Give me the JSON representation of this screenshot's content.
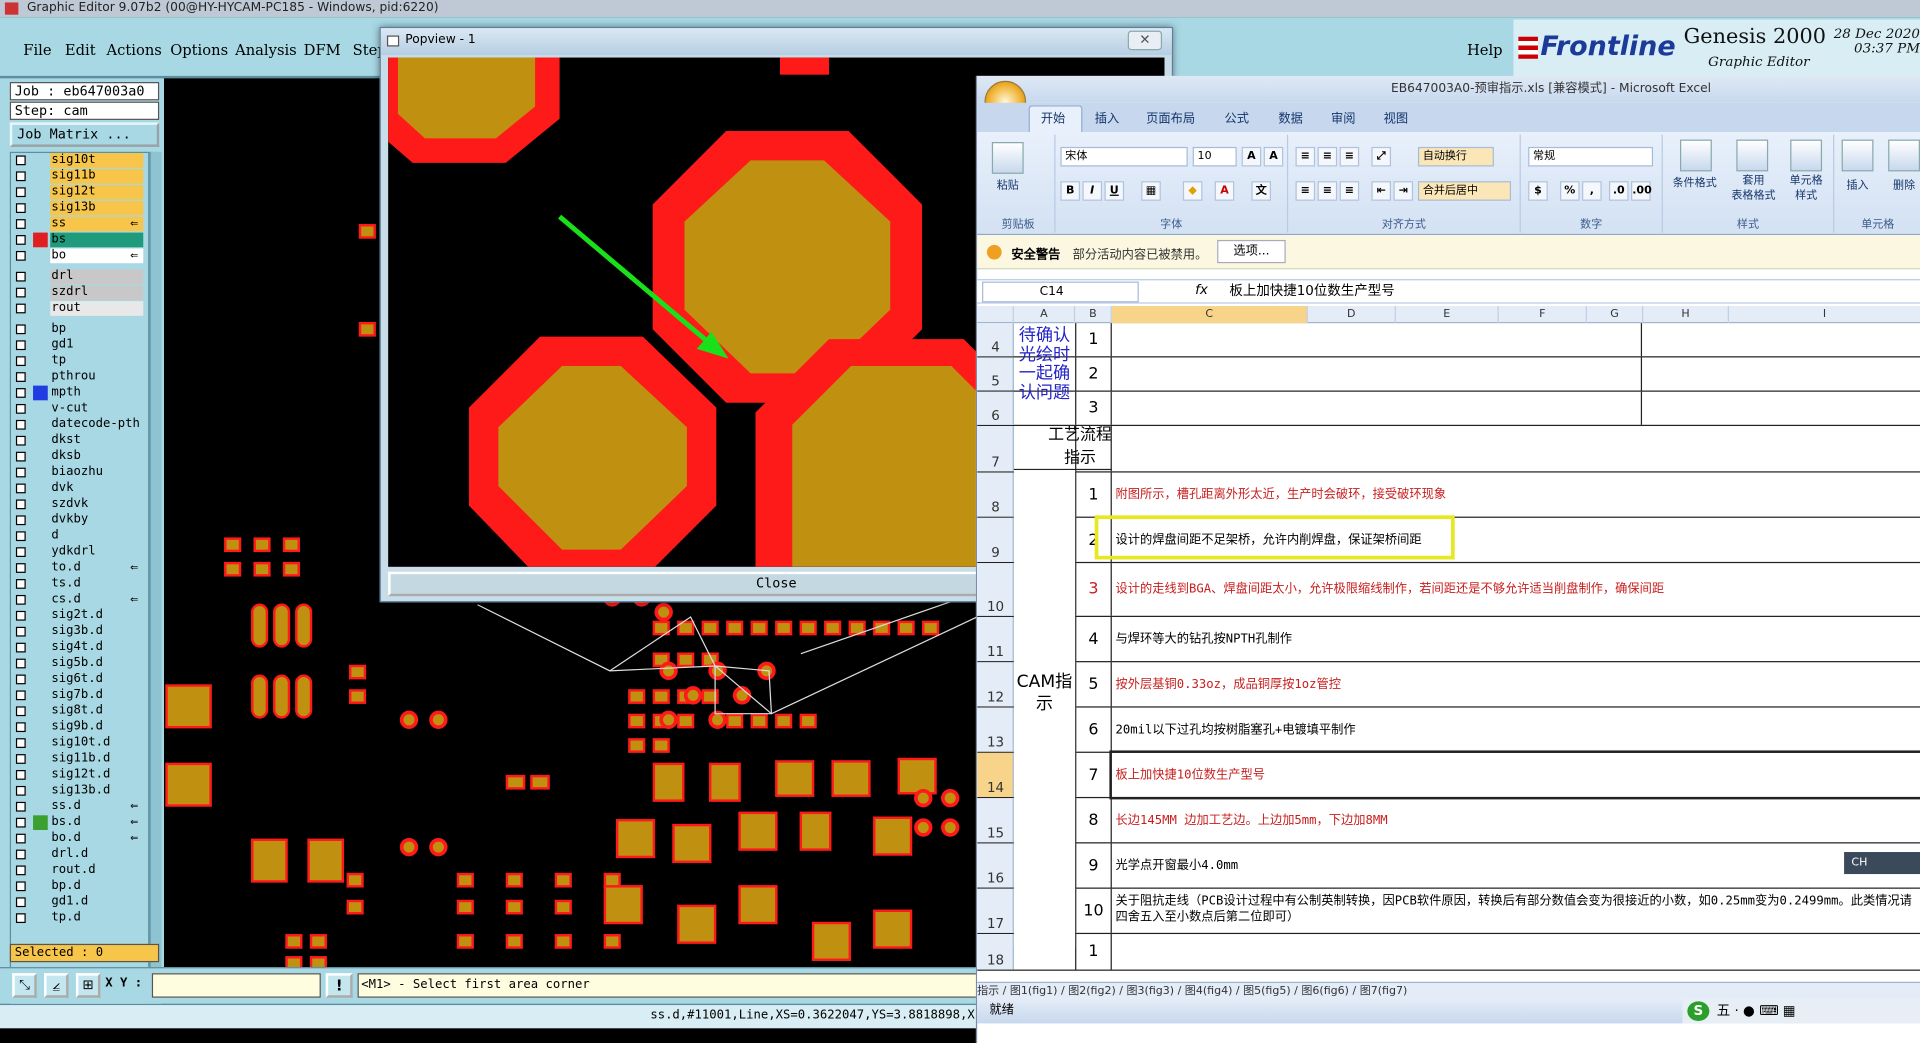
{
  "genesis": {
    "window_title": "Graphic Editor 9.07b2 (00@HY-HYCAM-PC185 - Windows, pid:6220)",
    "menu": [
      "File",
      "Edit",
      "Actions",
      "Options",
      "Analysis",
      "DFM",
      "Step"
    ],
    "help": "Help",
    "brand": "Frontline",
    "product": "Genesis 2000",
    "product_sub": "Graphic Editor",
    "date": "28 Dec 2020",
    "time": "03:37 PM",
    "job": "Job : eb647003a0",
    "step": "Step: cam",
    "job_matrix": "Job Matrix ...",
    "selected": "Selected : 0",
    "xy_label": "X Y :",
    "prompt": "<M1> - Select first area corner",
    "status": "ss.d,#11001,Line,XS=0.3622047,YS=3.8818898,X",
    "layers": [
      {
        "name": "sig10t",
        "bg": "#f6c54a",
        "mark": "",
        "flag": ""
      },
      {
        "name": "sig11b",
        "bg": "#f6c54a",
        "mark": "",
        "flag": ""
      },
      {
        "name": "sig12t",
        "bg": "#f6c54a",
        "mark": "",
        "flag": ""
      },
      {
        "name": "sig13b",
        "bg": "#f6c54a",
        "mark": "",
        "flag": ""
      },
      {
        "name": "ss",
        "bg": "#f6c54a",
        "mark": "",
        "flag": "⇐"
      },
      {
        "name": "bs",
        "bg": "#1f9a7a",
        "mark": "#e02020",
        "flag": ""
      },
      {
        "name": "bo",
        "bg": "#ffffff",
        "mark": "",
        "flag": "⇐"
      },
      {
        "name": "drl",
        "bg": "#c8c8c8",
        "mark": "",
        "flag": ""
      },
      {
        "name": "szdrl",
        "bg": "#c8c8c8",
        "mark": "",
        "flag": ""
      },
      {
        "name": "rout",
        "bg": "#e8e8e8",
        "mark": "",
        "flag": ""
      },
      {
        "name": "bp",
        "bg": "#a8d8e4",
        "mark": "",
        "flag": ""
      },
      {
        "name": "gd1",
        "bg": "#a8d8e4",
        "mark": "",
        "flag": ""
      },
      {
        "name": "tp",
        "bg": "#a8d8e4",
        "mark": "",
        "flag": ""
      },
      {
        "name": "pthrou",
        "bg": "#a8d8e4",
        "mark": "",
        "flag": ""
      },
      {
        "name": "mpth",
        "bg": "#a8d8e4",
        "mark": "#1f3de0",
        "flag": ""
      },
      {
        "name": "v-cut",
        "bg": "#a8d8e4",
        "mark": "",
        "flag": ""
      },
      {
        "name": "datecode-pth",
        "bg": "#a8d8e4",
        "mark": "",
        "flag": ""
      },
      {
        "name": "dkst",
        "bg": "#a8d8e4",
        "mark": "",
        "flag": ""
      },
      {
        "name": "dksb",
        "bg": "#a8d8e4",
        "mark": "",
        "flag": ""
      },
      {
        "name": "biaozhu",
        "bg": "#a8d8e4",
        "mark": "",
        "flag": ""
      },
      {
        "name": "dvk",
        "bg": "#a8d8e4",
        "mark": "",
        "flag": ""
      },
      {
        "name": "szdvk",
        "bg": "#a8d8e4",
        "mark": "",
        "flag": ""
      },
      {
        "name": "dvkby",
        "bg": "#a8d8e4",
        "mark": "",
        "flag": ""
      },
      {
        "name": "d",
        "bg": "#a8d8e4",
        "mark": "",
        "flag": ""
      },
      {
        "name": "ydkdrl",
        "bg": "#a8d8e4",
        "mark": "",
        "flag": ""
      },
      {
        "name": "to.d",
        "bg": "#a8d8e4",
        "mark": "",
        "flag": "⇐"
      },
      {
        "name": "ts.d",
        "bg": "#a8d8e4",
        "mark": "",
        "flag": ""
      },
      {
        "name": "cs.d",
        "bg": "#a8d8e4",
        "mark": "",
        "flag": "⇐"
      },
      {
        "name": "sig2t.d",
        "bg": "#a8d8e4",
        "mark": "",
        "flag": ""
      },
      {
        "name": "sig3b.d",
        "bg": "#a8d8e4",
        "mark": "",
        "flag": ""
      },
      {
        "name": "sig4t.d",
        "bg": "#a8d8e4",
        "mark": "",
        "flag": ""
      },
      {
        "name": "sig5b.d",
        "bg": "#a8d8e4",
        "mark": "",
        "flag": ""
      },
      {
        "name": "sig6t.d",
        "bg": "#a8d8e4",
        "mark": "",
        "flag": ""
      },
      {
        "name": "sig7b.d",
        "bg": "#a8d8e4",
        "mark": "",
        "flag": ""
      },
      {
        "name": "sig8t.d",
        "bg": "#a8d8e4",
        "mark": "",
        "flag": ""
      },
      {
        "name": "sig9b.d",
        "bg": "#a8d8e4",
        "mark": "",
        "flag": ""
      },
      {
        "name": "sig10t.d",
        "bg": "#a8d8e4",
        "mark": "",
        "flag": ""
      },
      {
        "name": "sig11b.d",
        "bg": "#a8d8e4",
        "mark": "",
        "flag": ""
      },
      {
        "name": "sig12t.d",
        "bg": "#a8d8e4",
        "mark": "",
        "flag": ""
      },
      {
        "name": "sig13b.d",
        "bg": "#a8d8e4",
        "mark": "",
        "flag": ""
      },
      {
        "name": "ss.d",
        "bg": "#a8d8e4",
        "mark": "",
        "flag": "⇐"
      },
      {
        "name": "bs.d",
        "bg": "#a8d8e4",
        "mark": "#3aa030",
        "flag": "⇐"
      },
      {
        "name": "bo.d",
        "bg": "#a8d8e4",
        "mark": "",
        "flag": "⇐"
      },
      {
        "name": "drl.d",
        "bg": "#a8d8e4",
        "mark": "",
        "flag": ""
      },
      {
        "name": "rout.d",
        "bg": "#a8d8e4",
        "mark": "",
        "flag": ""
      },
      {
        "name": "bp.d",
        "bg": "#a8d8e4",
        "mark": "",
        "flag": ""
      },
      {
        "name": "gd1.d",
        "bg": "#a8d8e4",
        "mark": "",
        "flag": ""
      },
      {
        "name": "tp.d",
        "bg": "#a8d8e4",
        "mark": "",
        "flag": ""
      }
    ]
  },
  "popview": {
    "title": "Popview - 1",
    "close": "Close"
  },
  "excel": {
    "title": "EB647003A0-预审指示.xls [兼容模式] - Microsoft Excel",
    "tabs": [
      "开始",
      "插入",
      "页面布局",
      "公式",
      "数据",
      "审阅",
      "视图"
    ],
    "ribbon": {
      "paste": "粘贴",
      "clipboard": "剪贴板",
      "font_name": "宋体",
      "font_size": "10",
      "font_group": "字体",
      "wrap": "自动换行",
      "merge": "合并后居中",
      "align_group": "对齐方式",
      "number_format": "常规",
      "number_group": "数字",
      "cond_format": "条件格式",
      "table_format": "套用\n表格格式",
      "cell_style": "单元格\n样式",
      "styles_group": "样式",
      "insert": "插入",
      "delete": "删除",
      "cells_group": "单元格"
    },
    "security_title": "安全警告",
    "security_text": "部分活动内容已被禁用。",
    "security_btn": "选项...",
    "namebox": "C14",
    "fx": "fx",
    "formula": "板上加快捷10位数生产型号",
    "columns": [
      "A",
      "B",
      "C",
      "D",
      "E",
      "F",
      "G",
      "H",
      "I"
    ],
    "label_confirm": "待确认光绘时一起确认问题",
    "label_process": "工艺流程指示",
    "label_cam": "CAM指示",
    "rows": [
      {
        "rn": "4",
        "b": "1",
        "text": "",
        "color": "#000"
      },
      {
        "rn": "5",
        "b": "2",
        "text": "",
        "color": "#000"
      },
      {
        "rn": "6",
        "b": "3",
        "text": "",
        "color": "#000"
      },
      {
        "rn": "7",
        "b": "",
        "text": "",
        "color": "#000"
      },
      {
        "rn": "8",
        "b": "1",
        "text": "附图所示，槽孔距离外形太近，生产时会破环，接受破环现象",
        "color": "#c81e1e"
      },
      {
        "rn": "9",
        "b": "2",
        "text": "设计的焊盘间距不足架桥，允许内削焊盘，保证架桥间距",
        "color": "#000"
      },
      {
        "rn": "10",
        "b": "3",
        "text": "设计的走线到BGA、焊盘间距太小，允许极限缩线制作，若间距还是不够允许适当削盘制作，确保间距",
        "color": "#c81e1e"
      },
      {
        "rn": "11",
        "b": "4",
        "text": "与焊环等大的钻孔按NPTH孔制作",
        "color": "#000"
      },
      {
        "rn": "12",
        "b": "5",
        "text": "按外层基铜0.33oz，成品铜厚按1oz管控",
        "color": "#c81e1e"
      },
      {
        "rn": "13",
        "b": "6",
        "text": "20mil以下过孔均按树脂塞孔+电镀填平制作",
        "color": "#000"
      },
      {
        "rn": "14",
        "b": "7",
        "text": "板上加快捷10位数生产型号",
        "color": "#c81e1e"
      },
      {
        "rn": "15",
        "b": "8",
        "text": "长边145MM 边加工艺边。上边加5mm，下边加8MM",
        "color": "#c81e1e"
      },
      {
        "rn": "16",
        "b": "9",
        "text": "光学点开窗最小4.0mm",
        "color": "#000"
      },
      {
        "rn": "17",
        "b": "10",
        "text": "关于阻抗走线（PCB设计过程中有公制英制转换，因PCB软件原因，转换后有部分数值会变为很接近的小数，如0.25mm变为0.2499mm。此类情况请四舍五入至小数点后第二位即可）",
        "color": "#000"
      },
      {
        "rn": "18",
        "b": "1",
        "text": "",
        "color": "#000"
      }
    ],
    "sheet_tabs": "指示 / 图1(fig1) / 图2(fig2) / 图3(fig3) / 图4(fig4) / 图5(fig5) / 图6(fig6) / 图7(fig7)",
    "status": "就绪",
    "ime": "CH",
    "tray": "五 · ● ⌨ ▦"
  }
}
